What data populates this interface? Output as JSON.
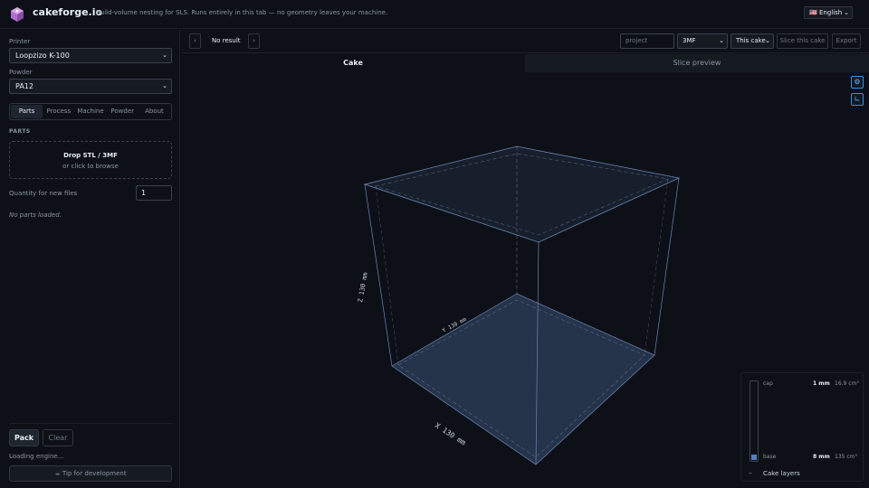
{
  "header": {
    "brand": "cakeforge.io",
    "tagline": "Build-volume nesting for SLS. Runs entirely in this tab — no geometry leaves your machine.",
    "language": "🇺🇸 English"
  },
  "sidebar": {
    "printer_label": "Printer",
    "printer_value": "Loopzizo K-100",
    "powder_label": "Powder",
    "powder_value": "PA12",
    "tabs": [
      {
        "label": "Parts",
        "active": true
      },
      {
        "label": "Process",
        "active": false
      },
      {
        "label": "Machine",
        "active": false
      },
      {
        "label": "Powder",
        "active": false
      },
      {
        "label": "About",
        "active": false
      }
    ],
    "section_title": "PARTS",
    "drop_main": "Drop STL / 3MF",
    "drop_sub": "or click to browse",
    "quantity_label": "Quantity for new files",
    "quantity_value": "1",
    "no_parts": "No parts loaded.",
    "pack_label": "Pack",
    "clear_label": "Clear",
    "loading": "Loading engine...",
    "tip_label": "Tip for development"
  },
  "toolbar": {
    "prev": "‹",
    "next": "›",
    "result": "No result",
    "project_placeholder": "project",
    "format_value": "3MF",
    "scope_value": "This cake",
    "slice_label": "Slice this cake",
    "export_label": "Export"
  },
  "views": {
    "cake_tab": "Cake",
    "slice_tab": "Slice preview"
  },
  "scene": {
    "x_label": "X 130 mm",
    "y_label": "Y 130 mm",
    "z_label": "Z 130 mm"
  },
  "layers": {
    "cap_label": "cap",
    "cap_mm": "1 mm",
    "cap_vol": "16.9 cm³",
    "base_label": "base",
    "base_mm": "8 mm",
    "base_vol": "135 cm³",
    "minus": "–",
    "title": "Cake layers",
    "fill_fraction": 0.07
  },
  "colors": {
    "accent": "#3f8ed6",
    "box_edge": "#6b86b4",
    "floor": "#2a3a55"
  }
}
